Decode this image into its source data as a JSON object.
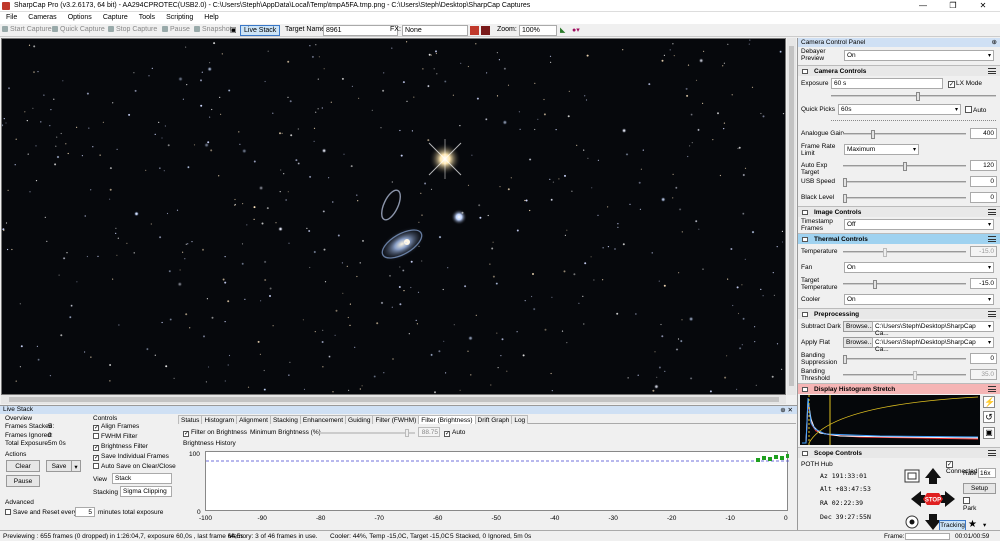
{
  "window": {
    "title": "SharpCap Pro (v3.2.6173, 64 bit) - AA294CPROTEC(USB2.0) - C:\\Users\\Steph\\AppData\\Local\\Temp\\tmpA5FA.tmp.png - C:\\Users\\Steph\\Desktop\\SharpCap Captures",
    "minimize": "—",
    "maximize": "❐",
    "close": "✕"
  },
  "menu": [
    "File",
    "Cameras",
    "Options",
    "Capture",
    "Tools",
    "Scripting",
    "Help"
  ],
  "toolbar": {
    "start_capture": "Start Capture",
    "quick_capture": "Quick Capture",
    "stop_capture": "Stop Capture",
    "pause": "Pause",
    "snapshot": "Snapshot",
    "live_stack": "Live Stack",
    "target_label": "Target Name:",
    "target_value": "8961",
    "fx_label": "FX:",
    "fx_value": "None",
    "zoom_label": "Zoom:",
    "zoom_value": "100%"
  },
  "panel": {
    "title": "Camera Control Panel",
    "pin": "⊕",
    "debayer_label": "Debayer Preview",
    "debayer_value": "On",
    "camera_controls": "Camera Controls",
    "exposure_label": "Exposure",
    "exposure_value": "60 s",
    "lx_label": "LX Mode",
    "quick_picks_label": "Quick Picks",
    "quick_picks_value": "60s",
    "auto_label": "Auto",
    "gain_label": "Analogue Gain",
    "gain_value": "400",
    "framerate_label": "Frame Rate Limit",
    "framerate_value": "Maximum",
    "autoexp_label": "Auto Exp Target",
    "autoexp_value": "120",
    "usb_label": "USB Speed",
    "usb_value": "0",
    "black_label": "Black Level",
    "black_value": "0",
    "image_controls": "Image Controls",
    "timestamp_label": "Timestamp Frames",
    "timestamp_value": "Off",
    "thermal_controls": "Thermal Controls",
    "temperature_label": "Temperature",
    "temperature_value": "-15.0",
    "fan_label": "Fan",
    "fan_value": "On",
    "target_temp_label": "Target Temperature",
    "target_temp_value": "-15.0",
    "cooler_label": "Cooler",
    "cooler_value": "On",
    "preprocessing": "Preprocessing",
    "dark_label": "Subtract Dark",
    "dark_button": "Browse...",
    "dark_path": "C:\\Users\\Steph\\Desktop\\SharpCap Ca...",
    "flat_label": "Apply Flat",
    "flat_button": "Browse...",
    "flat_path": "C:\\Users\\Steph\\Desktop\\SharpCap Ca...",
    "banding_sup_label": "Banding Suppression",
    "banding_sup_value": "0",
    "banding_thr_label": "Banding Threshold",
    "banding_thr_value": "35.0",
    "histogram": "Display Histogram Stretch",
    "scope_controls": "Scope Controls",
    "hub_label": "POTH Hub",
    "connected_label": "Connected",
    "az": "Az  191:33:01",
    "alt": "Alt +83:47:53",
    "ra": "RA  02:22:39",
    "dec": "Dec 39:27:55N",
    "rate_label": "Rate",
    "rate_value": "16x",
    "setup": "Setup",
    "park": "Park",
    "tracking": "Tracking",
    "stop": "STOP"
  },
  "livestack": {
    "title": "Live Stack",
    "pin": "⊕ ✕",
    "overview": "Overview",
    "stacked_label": "Frames Stacked:",
    "stacked_value": "5",
    "ignored_label": "Frames Ignored:",
    "ignored_value": "0",
    "exposure_label": "Total Exposure:",
    "exposure_value": "5m 0s",
    "actions": "Actions",
    "clear": "Clear",
    "save": "Save",
    "pause": "Pause",
    "advanced": "Advanced",
    "save_reset": "Save and Reset every",
    "reset_value": "5",
    "reset_unit": "minutes total exposure",
    "controls": "Controls",
    "align": "Align Frames",
    "fwhm": "FWHM Filter",
    "brightness": "Brightness Filter",
    "save_individual": "Save Individual Frames",
    "autosave": "Auto Save on Clear/Close",
    "view_label": "View",
    "view_value": "Stack",
    "stacking_label": "Stacking",
    "stacking_value": "Sigma Clipping",
    "tabs": [
      "Status",
      "Histogram",
      "Alignment",
      "Stacking",
      "Enhancement",
      "Guiding",
      "Filter (FWHM)",
      "Filter (Brightness)",
      "Drift Graph",
      "Log"
    ],
    "filter_on": "Filter on Brightness",
    "min_label": "Minimum Brightness (%)",
    "min_value": "88.75",
    "auto": "Auto",
    "graph_title": "Brightness History",
    "y_max": "100",
    "y_zero": "0",
    "x_ticks": [
      "-100",
      "-90",
      "-80",
      "-70",
      "-60",
      "-50",
      "-40",
      "-30",
      "-20",
      "-10",
      "0"
    ]
  },
  "status": {
    "preview": "Previewing : 655 frames (0 dropped) in 1:26:04,7, exposure 60,0s , last frame 64,5s",
    "memory": "Memory: 3 of 46 frames in use.",
    "cooler": "Cooler: 44%, Temp -15,0C, Target -15,0C",
    "stacked": "5 Stacked, 0 Ignored, 5m 0s",
    "frame_label": "Frame:",
    "elapsed": "00:01/00:59"
  },
  "colors": {
    "accent": "#3b79c9",
    "panel_header": "#cfe0f4",
    "thermal": "#9fd2f0",
    "histogram": "#f5b5b5",
    "stop": "#e02020"
  }
}
